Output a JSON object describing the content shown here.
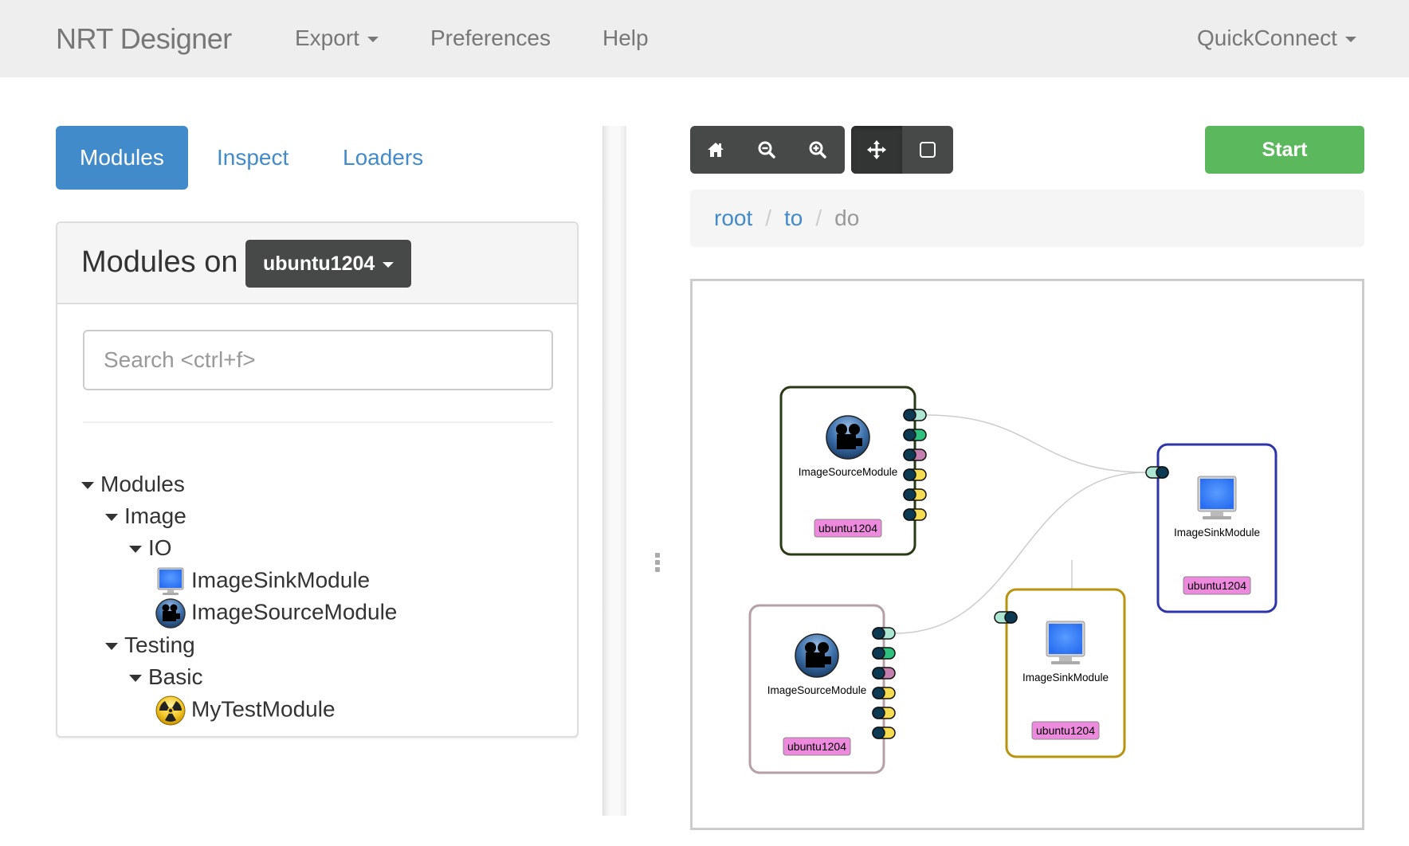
{
  "navbar": {
    "brand": "NRT Designer",
    "items": [
      {
        "label": "Export",
        "dropdown": true
      },
      {
        "label": "Preferences",
        "dropdown": false
      },
      {
        "label": "Help",
        "dropdown": false
      }
    ],
    "right_item": {
      "label": "QuickConnect",
      "dropdown": true
    }
  },
  "sidebar": {
    "tabs": [
      {
        "label": "Modules",
        "active": true
      },
      {
        "label": "Inspect",
        "active": false
      },
      {
        "label": "Loaders",
        "active": false
      }
    ],
    "panel_title": "Modules on",
    "host_selector": "ubuntu1204",
    "search": {
      "placeholder": "Search <ctrl+f>",
      "value": ""
    },
    "tree": [
      {
        "label": "Modules",
        "level": 0,
        "expanded": true,
        "icon": null
      },
      {
        "label": "Image",
        "level": 1,
        "expanded": true,
        "icon": null
      },
      {
        "label": "IO",
        "level": 2,
        "expanded": true,
        "icon": null
      },
      {
        "label": "ImageSinkModule",
        "level": 3,
        "icon": "monitor-icon"
      },
      {
        "label": "ImageSourceModule",
        "level": 3,
        "icon": "video-camera-icon"
      },
      {
        "label": "Testing",
        "level": 1,
        "expanded": true,
        "icon": null
      },
      {
        "label": "Basic",
        "level": 2,
        "expanded": true,
        "icon": null
      },
      {
        "label": "MyTestModule",
        "level": 3,
        "icon": "radiation-icon"
      }
    ]
  },
  "toolbar": {
    "view_buttons": [
      {
        "name": "home",
        "icon": "home-icon"
      },
      {
        "name": "zoom-out",
        "icon": "zoom-out-icon"
      },
      {
        "name": "zoom-in",
        "icon": "zoom-in-icon"
      }
    ],
    "mode_buttons": [
      {
        "name": "pan",
        "icon": "move-icon",
        "active": true
      },
      {
        "name": "select",
        "icon": "square-icon",
        "active": false
      }
    ],
    "start_label": "Start"
  },
  "breadcrumb": {
    "links": [
      "root",
      "to"
    ],
    "active": "do"
  },
  "graph": {
    "colors": {
      "port_dark": "#0b3a52",
      "port_mint": "#aee6d4",
      "port_green": "#2ec27e",
      "port_mauve": "#c47fae",
      "port_yellow": "#f5dc50",
      "host_badge": "#ee8ade",
      "edge": "#cccccc"
    },
    "nodes": [
      {
        "id": "src1",
        "type": "ImageSourceModule",
        "label": "ImageSourceModule",
        "host": "ubuntu1204",
        "border": "#2a3a18",
        "outputs": [
          "port_mint",
          "port_green",
          "port_mauve",
          "port_yellow",
          "port_yellow",
          "port_yellow"
        ],
        "inputs": []
      },
      {
        "id": "sink1",
        "type": "ImageSinkModule",
        "label": "ImageSinkModule",
        "host": "ubuntu1204",
        "border": "#2d35a8",
        "outputs": [],
        "inputs": [
          "port_mint"
        ]
      },
      {
        "id": "src2",
        "type": "ImageSourceModule",
        "label": "ImageSourceModule",
        "host": "ubuntu1204",
        "border": "#b5a0a8",
        "outputs": [
          "port_mint",
          "port_green",
          "port_mauve",
          "port_yellow",
          "port_yellow",
          "port_yellow"
        ],
        "inputs": []
      },
      {
        "id": "sink2",
        "type": "ImageSinkModule",
        "label": "ImageSinkModule",
        "host": "ubuntu1204",
        "border": "#b8930e",
        "outputs": [],
        "inputs": [
          "port_mint"
        ]
      }
    ],
    "edges": [
      {
        "from": "src1",
        "from_port": 0,
        "to": "sink1",
        "to_port": 0
      },
      {
        "from": "src2",
        "from_port": 0,
        "to": "sink1",
        "to_port": 0
      }
    ]
  }
}
